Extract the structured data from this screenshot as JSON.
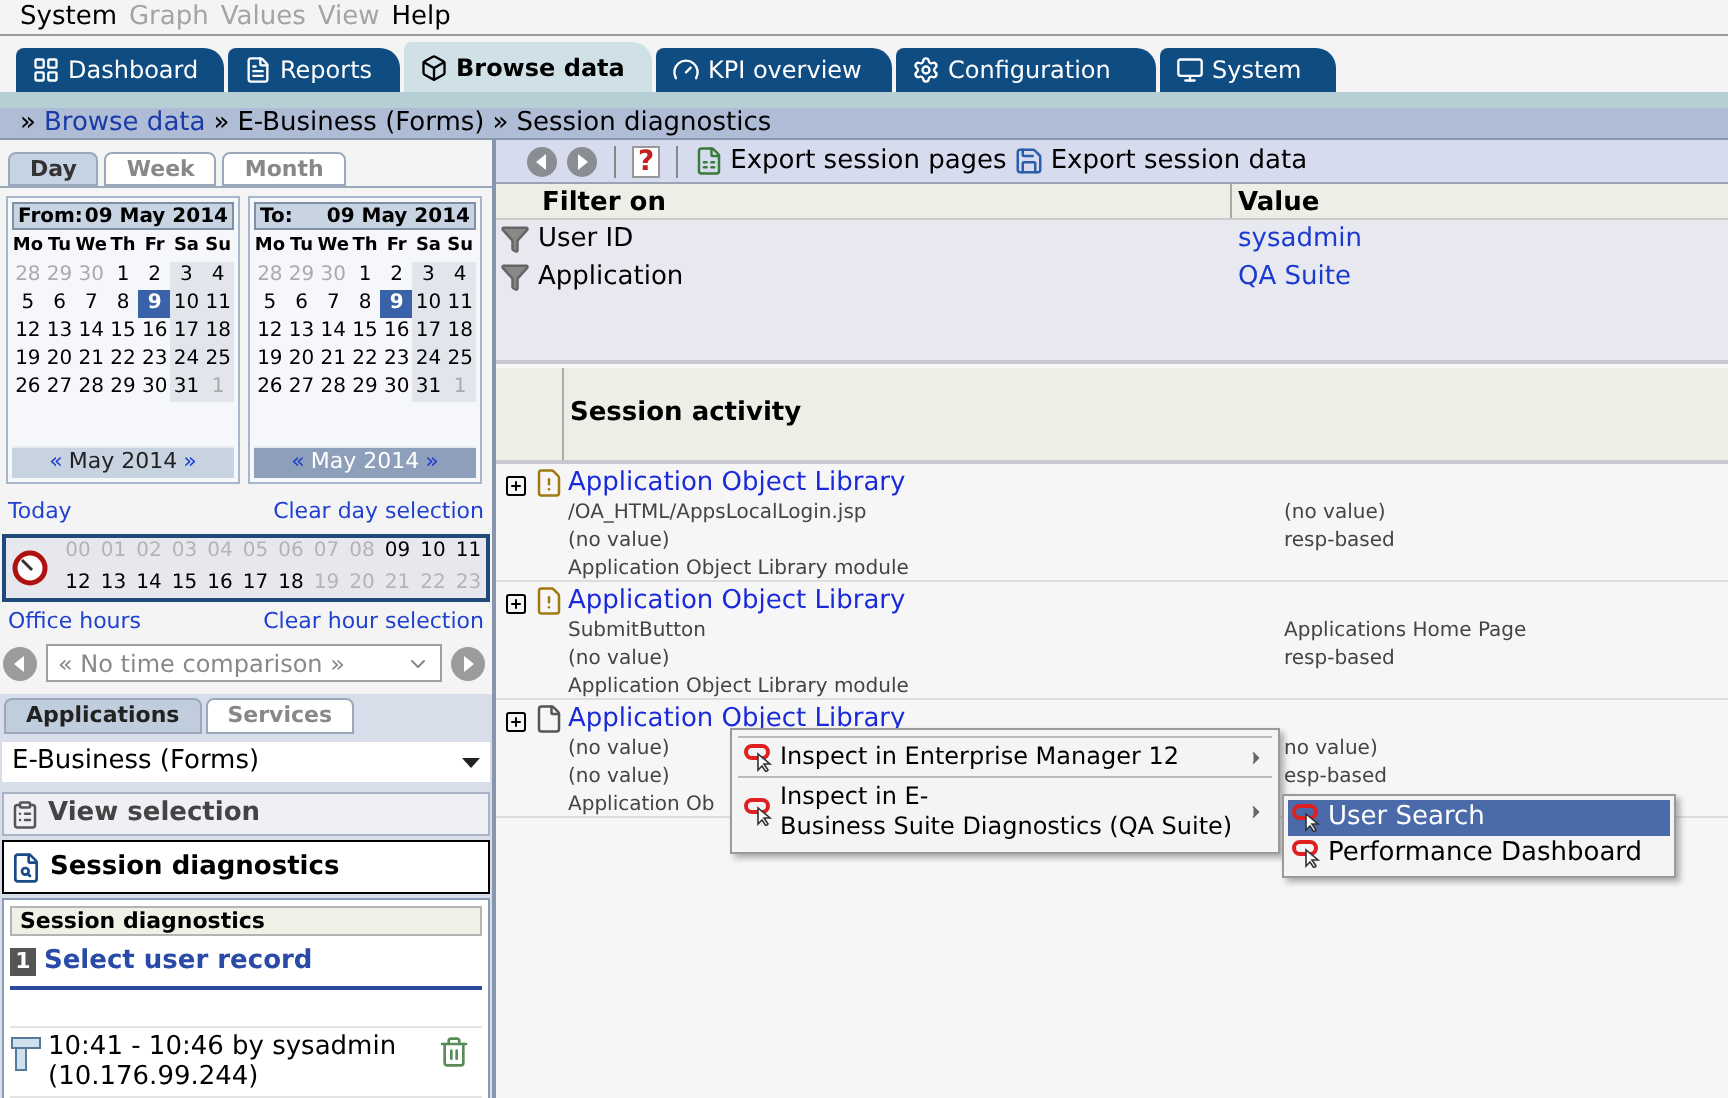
{
  "menu": [
    {
      "label": "System",
      "disabled": false
    },
    {
      "label": "Graph",
      "disabled": true
    },
    {
      "label": "Values",
      "disabled": true
    },
    {
      "label": "View",
      "disabled": true
    },
    {
      "label": "Help",
      "disabled": false
    }
  ],
  "tabs": [
    {
      "label": "Dashboard",
      "kind": "grid",
      "selected": false
    },
    {
      "label": "Reports",
      "kind": "report",
      "selected": false
    },
    {
      "label": "Browse data",
      "kind": "cube",
      "selected": true
    },
    {
      "label": "KPI overview",
      "kind": "gauge",
      "selected": false
    },
    {
      "label": "Configuration",
      "kind": "gear",
      "selected": false
    },
    {
      "label": "System",
      "kind": "monitor",
      "selected": false
    }
  ],
  "breadcrumb": {
    "separator": "»",
    "items": [
      {
        "label": "Browse data",
        "link": true
      },
      {
        "label": "E-Business (Forms)",
        "link": false
      },
      {
        "label": "Session diagnostics",
        "link": false
      }
    ]
  },
  "period_tabs": [
    {
      "label": "Day",
      "selected": true
    },
    {
      "label": "Week",
      "selected": false
    },
    {
      "label": "Month",
      "selected": false
    }
  ],
  "calendars": [
    {
      "label": "From:",
      "date": "09 May 2014",
      "prev": "«",
      "month": "May 2014",
      "next": "»",
      "month_disabled": false,
      "weekdays": [
        "Mo",
        "Tu",
        "We",
        "Th",
        "Fr",
        "Sa",
        "Su"
      ],
      "days": [
        {
          "d": "28",
          "muted": true,
          "selected": false
        },
        {
          "d": "29",
          "muted": true,
          "selected": false
        },
        {
          "d": "30",
          "muted": true,
          "selected": false
        },
        {
          "d": "1",
          "muted": false,
          "selected": false
        },
        {
          "d": "2",
          "muted": false,
          "selected": false
        },
        {
          "d": "3",
          "muted": false,
          "selected": false
        },
        {
          "d": "4",
          "muted": false,
          "selected": false
        },
        {
          "d": "5",
          "muted": false,
          "selected": false
        },
        {
          "d": "6",
          "muted": false,
          "selected": false
        },
        {
          "d": "7",
          "muted": false,
          "selected": false
        },
        {
          "d": "8",
          "muted": false,
          "selected": false
        },
        {
          "d": "9",
          "muted": false,
          "selected": true
        },
        {
          "d": "10",
          "muted": false,
          "selected": false
        },
        {
          "d": "11",
          "muted": false,
          "selected": false
        },
        {
          "d": "12",
          "muted": false,
          "selected": false
        },
        {
          "d": "13",
          "muted": false,
          "selected": false
        },
        {
          "d": "14",
          "muted": false,
          "selected": false
        },
        {
          "d": "15",
          "muted": false,
          "selected": false
        },
        {
          "d": "16",
          "muted": false,
          "selected": false
        },
        {
          "d": "17",
          "muted": false,
          "selected": false
        },
        {
          "d": "18",
          "muted": false,
          "selected": false
        },
        {
          "d": "19",
          "muted": false,
          "selected": false
        },
        {
          "d": "20",
          "muted": false,
          "selected": false
        },
        {
          "d": "21",
          "muted": false,
          "selected": false
        },
        {
          "d": "22",
          "muted": false,
          "selected": false
        },
        {
          "d": "23",
          "muted": false,
          "selected": false
        },
        {
          "d": "24",
          "muted": false,
          "selected": false
        },
        {
          "d": "25",
          "muted": false,
          "selected": false
        },
        {
          "d": "26",
          "muted": false,
          "selected": false
        },
        {
          "d": "27",
          "muted": false,
          "selected": false
        },
        {
          "d": "28",
          "muted": false,
          "selected": false
        },
        {
          "d": "29",
          "muted": false,
          "selected": false
        },
        {
          "d": "30",
          "muted": false,
          "selected": false
        },
        {
          "d": "31",
          "muted": false,
          "selected": false
        },
        {
          "d": "1",
          "muted": true,
          "selected": false
        }
      ]
    },
    {
      "label": "To:",
      "date": "09 May 2014",
      "prev": "«",
      "month": "May 2014",
      "next": "»",
      "month_disabled": true,
      "weekdays": [
        "Mo",
        "Tu",
        "We",
        "Th",
        "Fr",
        "Sa",
        "Su"
      ],
      "days": [
        {
          "d": "28",
          "muted": true,
          "selected": false
        },
        {
          "d": "29",
          "muted": true,
          "selected": false
        },
        {
          "d": "30",
          "muted": true,
          "selected": false
        },
        {
          "d": "1",
          "muted": false,
          "selected": false
        },
        {
          "d": "2",
          "muted": false,
          "selected": false
        },
        {
          "d": "3",
          "muted": false,
          "selected": false
        },
        {
          "d": "4",
          "muted": false,
          "selected": false
        },
        {
          "d": "5",
          "muted": false,
          "selected": false
        },
        {
          "d": "6",
          "muted": false,
          "selected": false
        },
        {
          "d": "7",
          "muted": false,
          "selected": false
        },
        {
          "d": "8",
          "muted": false,
          "selected": false
        },
        {
          "d": "9",
          "muted": false,
          "selected": true
        },
        {
          "d": "10",
          "muted": false,
          "selected": false
        },
        {
          "d": "11",
          "muted": false,
          "selected": false
        },
        {
          "d": "12",
          "muted": false,
          "selected": false
        },
        {
          "d": "13",
          "muted": false,
          "selected": false
        },
        {
          "d": "14",
          "muted": false,
          "selected": false
        },
        {
          "d": "15",
          "muted": false,
          "selected": false
        },
        {
          "d": "16",
          "muted": false,
          "selected": false
        },
        {
          "d": "17",
          "muted": false,
          "selected": false
        },
        {
          "d": "18",
          "muted": false,
          "selected": false
        },
        {
          "d": "19",
          "muted": false,
          "selected": false
        },
        {
          "d": "20",
          "muted": false,
          "selected": false
        },
        {
          "d": "21",
          "muted": false,
          "selected": false
        },
        {
          "d": "22",
          "muted": false,
          "selected": false
        },
        {
          "d": "23",
          "muted": false,
          "selected": false
        },
        {
          "d": "24",
          "muted": false,
          "selected": false
        },
        {
          "d": "25",
          "muted": false,
          "selected": false
        },
        {
          "d": "26",
          "muted": false,
          "selected": false
        },
        {
          "d": "27",
          "muted": false,
          "selected": false
        },
        {
          "d": "28",
          "muted": false,
          "selected": false
        },
        {
          "d": "29",
          "muted": false,
          "selected": false
        },
        {
          "d": "30",
          "muted": false,
          "selected": false
        },
        {
          "d": "31",
          "muted": false,
          "selected": false
        },
        {
          "d": "1",
          "muted": true,
          "selected": false
        }
      ]
    }
  ],
  "day_links": {
    "left": "Today",
    "right": "Clear day selection"
  },
  "hours": [
    {
      "h": "00",
      "active": false
    },
    {
      "h": "01",
      "active": false
    },
    {
      "h": "02",
      "active": false
    },
    {
      "h": "03",
      "active": false
    },
    {
      "h": "04",
      "active": false
    },
    {
      "h": "05",
      "active": false
    },
    {
      "h": "06",
      "active": false
    },
    {
      "h": "07",
      "active": false
    },
    {
      "h": "08",
      "active": false
    },
    {
      "h": "09",
      "active": true
    },
    {
      "h": "10",
      "active": true
    },
    {
      "h": "11",
      "active": true
    },
    {
      "h": "12",
      "active": true
    },
    {
      "h": "13",
      "active": true
    },
    {
      "h": "14",
      "active": true
    },
    {
      "h": "15",
      "active": true
    },
    {
      "h": "16",
      "active": true
    },
    {
      "h": "17",
      "active": true
    },
    {
      "h": "18",
      "active": true
    },
    {
      "h": "19",
      "active": false
    },
    {
      "h": "20",
      "active": false
    },
    {
      "h": "21",
      "active": false
    },
    {
      "h": "22",
      "active": false
    },
    {
      "h": "23",
      "active": false
    }
  ],
  "hour_links": {
    "left": "Office hours",
    "right": "Clear hour selection"
  },
  "comparison": {
    "value": "« No time comparison »"
  },
  "app_tabs": [
    {
      "label": "Applications",
      "selected": true
    },
    {
      "label": "Services",
      "selected": false
    }
  ],
  "application": {
    "value": "E-Business (Forms)"
  },
  "nav_panels": [
    {
      "label": "View selection",
      "kind": "clipboard",
      "selected": false
    },
    {
      "label": "Session diagnostics",
      "kind": "inspect",
      "selected": true
    }
  ],
  "diagnostics": {
    "header": "Session diagnostics",
    "step": "1",
    "step_label": "Select user record",
    "record": {
      "line1": "10:41 - 10:46 by sysadmin",
      "line2": "(10.176.99.244)"
    }
  },
  "toolbar": [
    {
      "kind": "back"
    },
    {
      "kind": "forward"
    },
    {
      "kind": "help",
      "label": "?"
    },
    {
      "kind": "export-pages",
      "label": "Export session pages"
    },
    {
      "kind": "export-data",
      "label": "Export session data"
    }
  ],
  "filters": {
    "columns": [
      "Filter on",
      "Value"
    ],
    "rows": [
      {
        "name": "User ID",
        "value": "sysadmin"
      },
      {
        "name": "Application",
        "value": "QA Suite"
      }
    ]
  },
  "activity": {
    "header": "Session activity",
    "rows": [
      {
        "kind": "warning",
        "title": "Application Object Library",
        "left": [
          "/OA_HTML/AppsLocalLogin.jsp",
          "(no value)",
          "Application Object Library module"
        ],
        "right": [
          "(no value)",
          "resp-based"
        ]
      },
      {
        "kind": "warning",
        "title": "Application Object Library",
        "left": [
          "SubmitButton",
          "(no value)",
          "Application Object Library module"
        ],
        "right": [
          "Applications Home Page",
          "resp-based"
        ]
      },
      {
        "kind": "page",
        "title": "Application Object Library",
        "left": [
          "(no value)",
          "(no value)",
          "Application Ob"
        ],
        "right": [
          "no value)",
          "esp-based"
        ]
      }
    ]
  },
  "context_menu": {
    "items": [
      {
        "label": "Inspect in Enterprise Manager 12",
        "has_submenu": true
      },
      {
        "label": "Inspect in E-\nBusiness Suite Diagnostics (QA Suite)",
        "has_submenu": true
      }
    ],
    "submenu": [
      {
        "label": "User Search",
        "selected": true
      },
      {
        "label": "Performance Dashboard",
        "selected": false
      }
    ]
  }
}
